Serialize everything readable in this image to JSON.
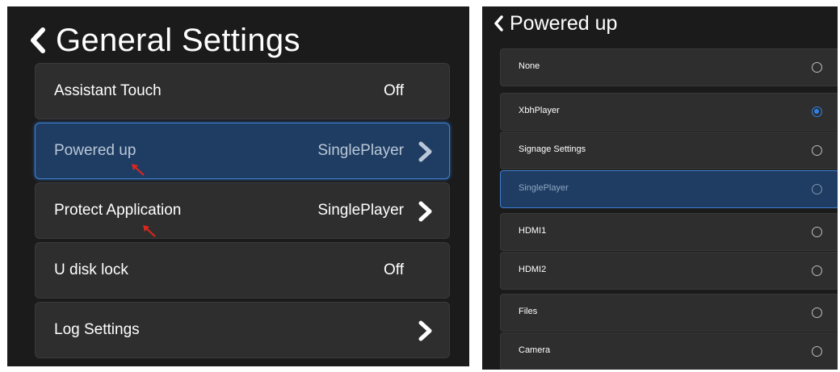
{
  "general": {
    "title": "General Settings",
    "rows": [
      {
        "label": "Assistant Touch",
        "value": "Off"
      },
      {
        "label": "Powered up",
        "value": "SinglePlayer"
      },
      {
        "label": "Protect Application",
        "value": "SinglePlayer"
      },
      {
        "label": "U disk lock",
        "value": "Off"
      },
      {
        "label": "Log Settings",
        "value": ""
      }
    ]
  },
  "powered_up": {
    "title": "Powered up",
    "options": [
      {
        "label": "None",
        "checked": false
      },
      {
        "label": "XbhPlayer",
        "checked": true
      },
      {
        "label": "Signage Settings",
        "checked": false
      },
      {
        "label": "SinglePlayer",
        "checked": false
      },
      {
        "label": "HDMI1",
        "checked": false
      },
      {
        "label": "HDMI2",
        "checked": false
      },
      {
        "label": "Files",
        "checked": false
      },
      {
        "label": "Camera",
        "checked": false
      }
    ]
  },
  "colors": {
    "background": "#1b1b1b",
    "row": "#2e2e2e",
    "selected_row": "#1f3d62",
    "selected_border": "#3f7fd0",
    "radio_checked": "#2f83e6",
    "annotation_arrow": "#e0261b"
  }
}
